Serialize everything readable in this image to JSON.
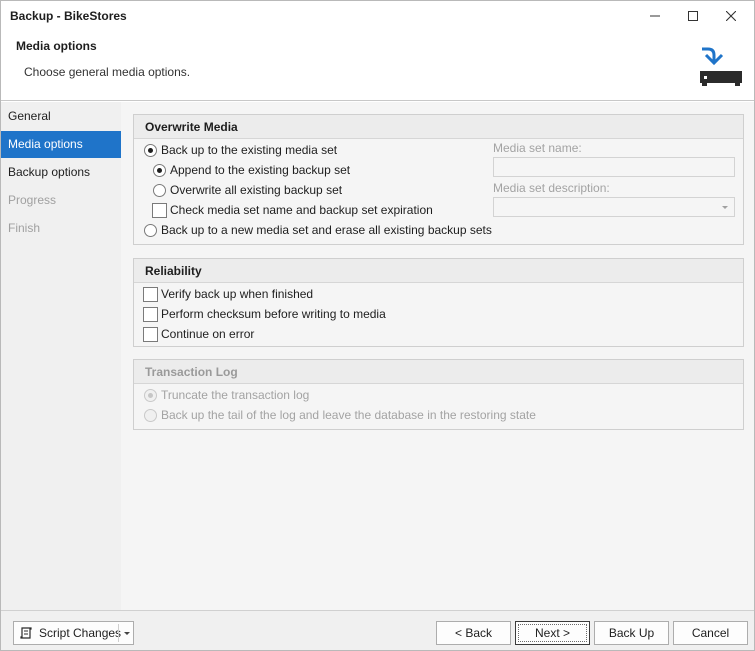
{
  "window": {
    "title": "Backup - BikeStores",
    "minimize_label": "Minimize",
    "maximize_label": "Maximize",
    "close_label": "Close"
  },
  "header": {
    "title": "Media options",
    "subtitle": "Choose general media options.",
    "icon": "backup-to-device-icon"
  },
  "sidebar": {
    "items": [
      {
        "label": "General",
        "state": "normal"
      },
      {
        "label": "Media options",
        "state": "active"
      },
      {
        "label": "Backup options",
        "state": "normal"
      },
      {
        "label": "Progress",
        "state": "disabled"
      },
      {
        "label": "Finish",
        "state": "disabled"
      }
    ]
  },
  "overwrite_media": {
    "heading": "Overwrite Media",
    "backup_existing": {
      "label": "Back up to the existing media set",
      "selected": true
    },
    "append_existing": {
      "label": "Append to the existing backup set",
      "selected": true
    },
    "overwrite_all": {
      "label": "Overwrite all existing backup set",
      "selected": false
    },
    "check_media": {
      "label": "Check media set name and backup set expiration",
      "checked": false
    },
    "backup_new": {
      "label": "Back up to a new media set and erase all existing backup sets",
      "selected": false
    },
    "media_set_name": {
      "label": "Media set name:",
      "value": ""
    },
    "media_set_description": {
      "label": "Media set description:",
      "value": ""
    }
  },
  "reliability": {
    "heading": "Reliability",
    "verify": {
      "label": "Verify back up when finished",
      "checked": false
    },
    "checksum": {
      "label": "Perform checksum before writing to media",
      "checked": false
    },
    "continue_on_error": {
      "label": "Continue on error",
      "checked": false
    }
  },
  "transaction_log": {
    "heading": "Transaction Log",
    "truncate": {
      "label": "Truncate the transaction log",
      "selected": true
    },
    "backup_tail": {
      "label": "Back up the tail of the log and leave the database in the restoring state",
      "selected": false
    }
  },
  "footer": {
    "script_changes": "Script Changes",
    "back": "< Back",
    "next": "Next >",
    "back_up": "Back Up",
    "cancel": "Cancel"
  },
  "colors": {
    "accent": "#1f74c9",
    "icon_blue": "#1f74c9",
    "icon_dark": "#2b2b2b"
  }
}
